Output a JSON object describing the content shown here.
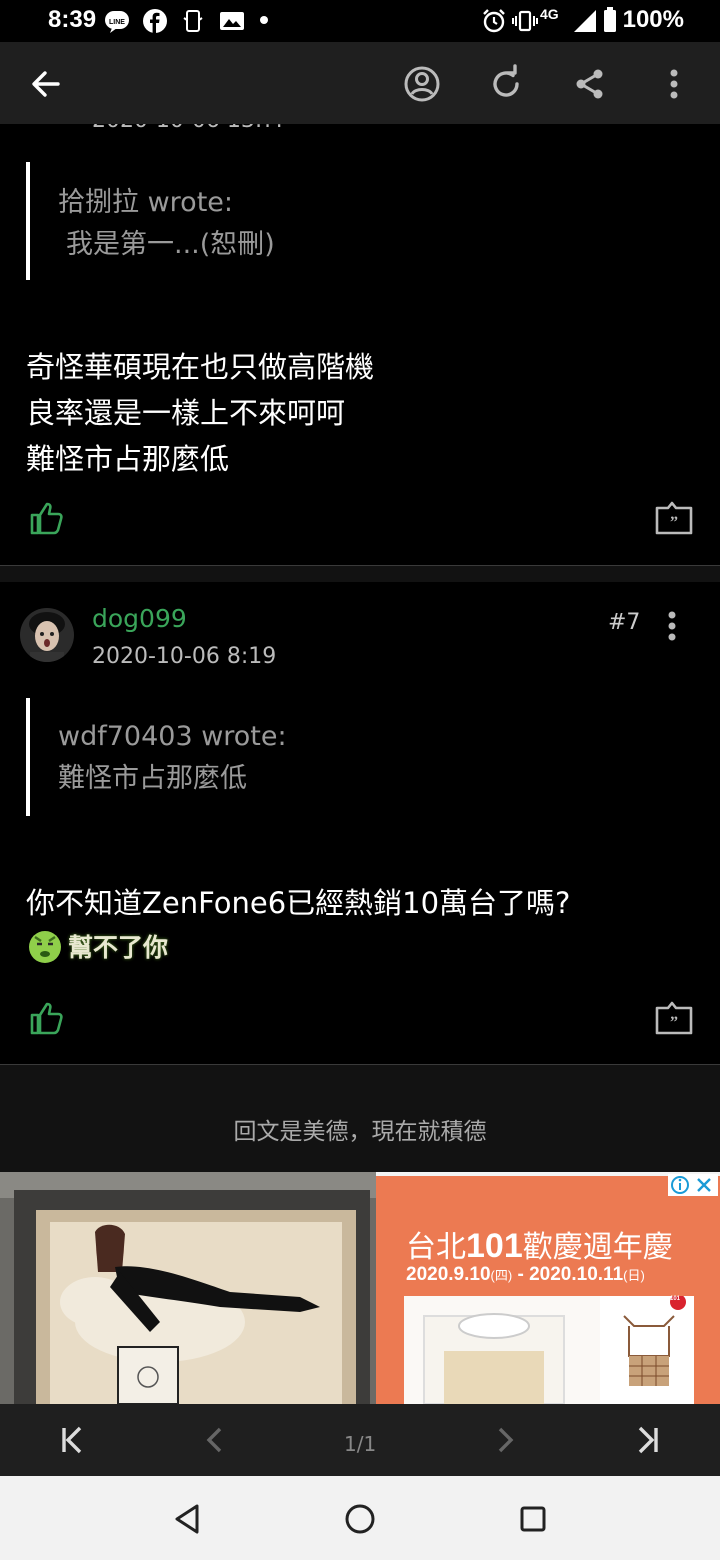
{
  "status_bar": {
    "time": "8:39",
    "network": "4G",
    "battery": "100%"
  },
  "toolbar": {
    "back_icon": "arrow-left-icon",
    "account_icon": "account-circle-icon",
    "refresh_icon": "refresh-icon",
    "share_icon": "share-icon",
    "more_icon": "more-vertical-icon"
  },
  "post_6": {
    "partial_date": "2020-10-06 13:??",
    "quote_author": "拾捌拉 wrote:",
    "quote_text": "我是第一...(恕刪)",
    "body_lines": [
      "奇怪華碩現在也只做高階機",
      "良率還是一樣上不來呵呵",
      "難怪市占那麼低"
    ]
  },
  "post_7": {
    "username": "dog099",
    "date": "2020-10-06 8:19",
    "floor": "#7",
    "quote_author": "wdf70403 wrote:",
    "quote_text": "難怪市占那麼低",
    "body_line": "你不知道ZenFone6已經熱銷10萬台了嗎?",
    "sticker_text": "幫不了你"
  },
  "footer_message": "回文是美德，現在就積德",
  "ad": {
    "title_prefix": "台北",
    "title_number": "101",
    "title_suffix": "歡慶週年慶",
    "date_start": "2020.9.10",
    "date_start_day": "(四)",
    "date_sep": " - ",
    "date_end": "2020.10.11",
    "date_end_day": "(日)",
    "badge": "101"
  },
  "pager": {
    "page": "1/1"
  },
  "colors": {
    "accent_green": "#3aa55a",
    "toolbar_bg": "#1f1f1f",
    "ad_orange": "#ec7a52"
  }
}
